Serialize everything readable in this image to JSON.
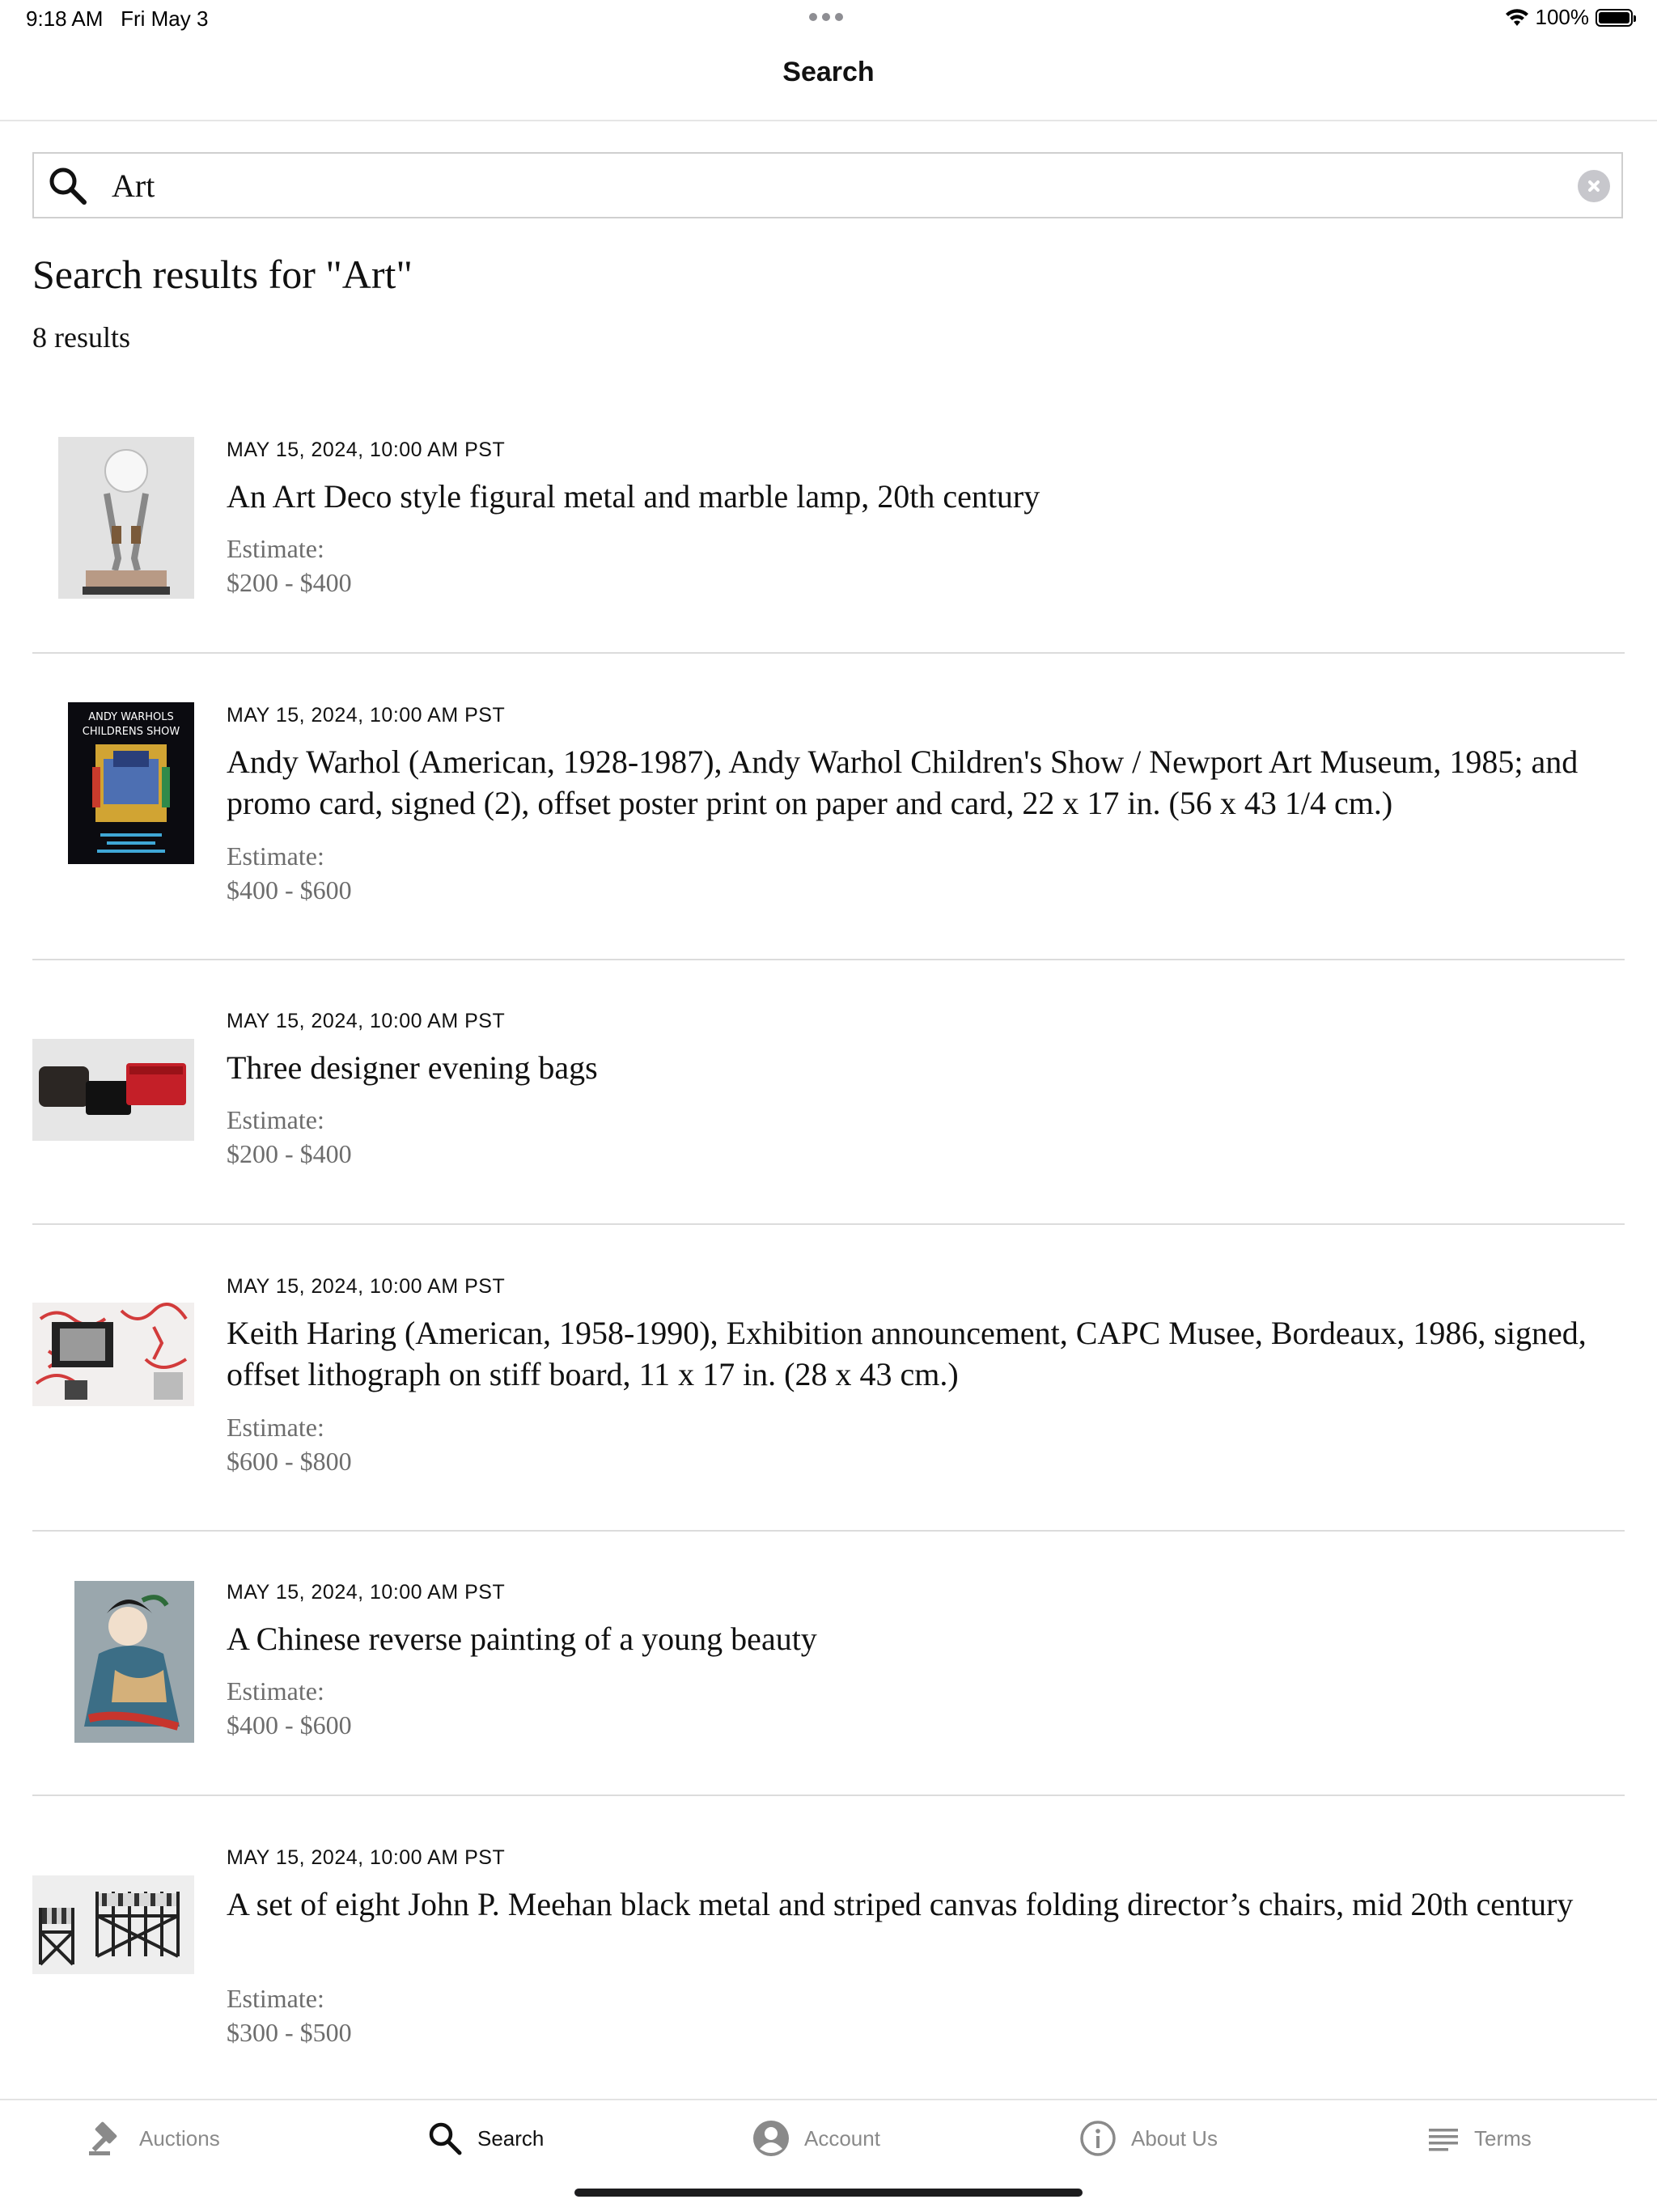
{
  "status_bar": {
    "time": "9:18 AM",
    "date": "Fri May 3",
    "battery_percent": "100%",
    "battery_level": 1.0
  },
  "nav": {
    "title": "Search"
  },
  "search": {
    "query": "Art",
    "placeholder": ""
  },
  "results": {
    "heading": "Search results for \"Art\"",
    "count": "8 results",
    "estimate_label": "Estimate:",
    "items": [
      {
        "date": "MAY 15, 2024, 10:00 AM PST",
        "title": "An Art Deco style figural metal and marble lamp, 20th century",
        "estimate": "$200 - $400"
      },
      {
        "date": "MAY 15, 2024, 10:00 AM PST",
        "title": "Andy Warhol (American, 1928-1987), Andy Warhol Children's Show / Newport Art Museum, 1985; and promo card, signed (2), offset poster print on paper and card, 22 x 17 in. (56 x 43 1/4 cm.)",
        "estimate": "$400 - $600"
      },
      {
        "date": "MAY 15, 2024, 10:00 AM PST",
        "title": "Three designer evening bags",
        "estimate": "$200 - $400"
      },
      {
        "date": "MAY 15, 2024, 10:00 AM PST",
        "title": "Keith Haring (American, 1958-1990), Exhibition announcement, CAPC Musee, Bordeaux, 1986, signed, offset lithograph on stiff board, 11 x 17 in. (28 x 43 cm.)",
        "estimate": "$600 - $800"
      },
      {
        "date": "MAY 15, 2024, 10:00 AM PST",
        "title": "A Chinese reverse painting of a young beauty",
        "estimate": "$400 - $600"
      },
      {
        "date": "MAY 15, 2024, 10:00 AM PST",
        "title": "A set of eight John P. Meehan black metal and striped canvas folding director’s chairs, mid 20th century",
        "estimate": "$300 - $500"
      }
    ]
  },
  "tab_bar": {
    "tabs": [
      {
        "label": "Auctions",
        "icon": "gavel-icon"
      },
      {
        "label": "Search",
        "icon": "search-icon",
        "active": true
      },
      {
        "label": "Account",
        "icon": "account-icon"
      },
      {
        "label": "About Us",
        "icon": "info-icon"
      },
      {
        "label": "Terms",
        "icon": "list-icon"
      }
    ]
  },
  "colors": {
    "text": "#111111",
    "muted": "#6d6d6d",
    "tab_inactive": "#8a8a8a",
    "divider": "#dcdcdc"
  }
}
